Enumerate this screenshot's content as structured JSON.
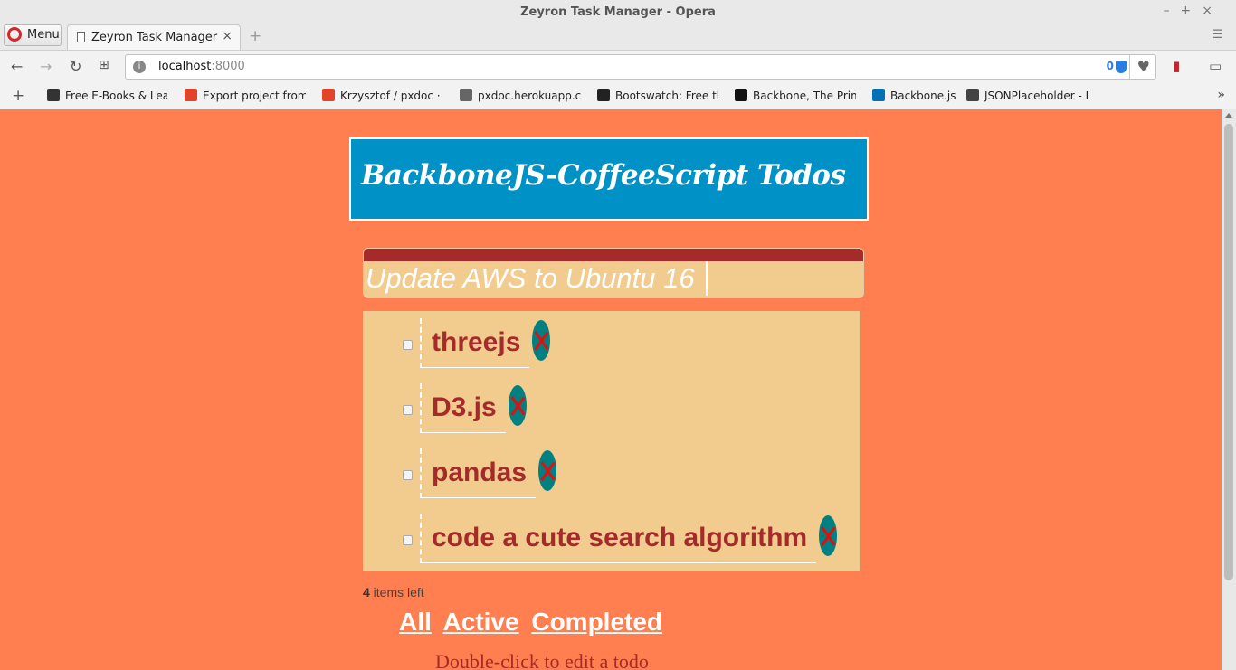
{
  "window": {
    "title": "Zeyron Task Manager - Opera"
  },
  "tabs": {
    "menu_label": "Menu",
    "active_tab": "Zeyron Task Manager",
    "close": "×",
    "new_tab": "+"
  },
  "address": {
    "host": "localhost",
    "port": ":8000",
    "shield_count": "0"
  },
  "bookmarks": [
    {
      "label": "Free E-Books & Lear",
      "color": "#333333"
    },
    {
      "label": "Export project from",
      "color": "#e24329"
    },
    {
      "label": "Krzysztof / pxdoc · G",
      "color": "#e24329"
    },
    {
      "label": "pxdoc.herokuapp.co",
      "color": "#666666"
    },
    {
      "label": "Bootswatch: Free the",
      "color": "#222222"
    },
    {
      "label": "Backbone, The Prim",
      "color": "#111111"
    },
    {
      "label": "Backbone.js",
      "color": "#0071b5"
    },
    {
      "label": "JSONPlaceholder - F",
      "color": "#444444"
    }
  ],
  "app": {
    "title": "BackboneJS-CoffeeScript Todos",
    "new_todo_value": "Update AWS to Ubuntu 16",
    "todos": [
      {
        "text": "threejs",
        "completed": false
      },
      {
        "text": "D3.js",
        "completed": false
      },
      {
        "text": "pandas",
        "completed": false
      },
      {
        "text": "code a cute search algorithm",
        "completed": false
      }
    ],
    "count_number": "4",
    "count_suffix": " items left",
    "filters": {
      "all": "All",
      "active": "Active",
      "completed": "Completed"
    },
    "hint": "Double-click to edit a todo"
  },
  "colors": {
    "page_bg": "#ff7f50",
    "header_bg": "#0092c7",
    "panel_bg": "#f2cc8f",
    "accent": "#a52a2a",
    "delete_bg": "#008080"
  }
}
